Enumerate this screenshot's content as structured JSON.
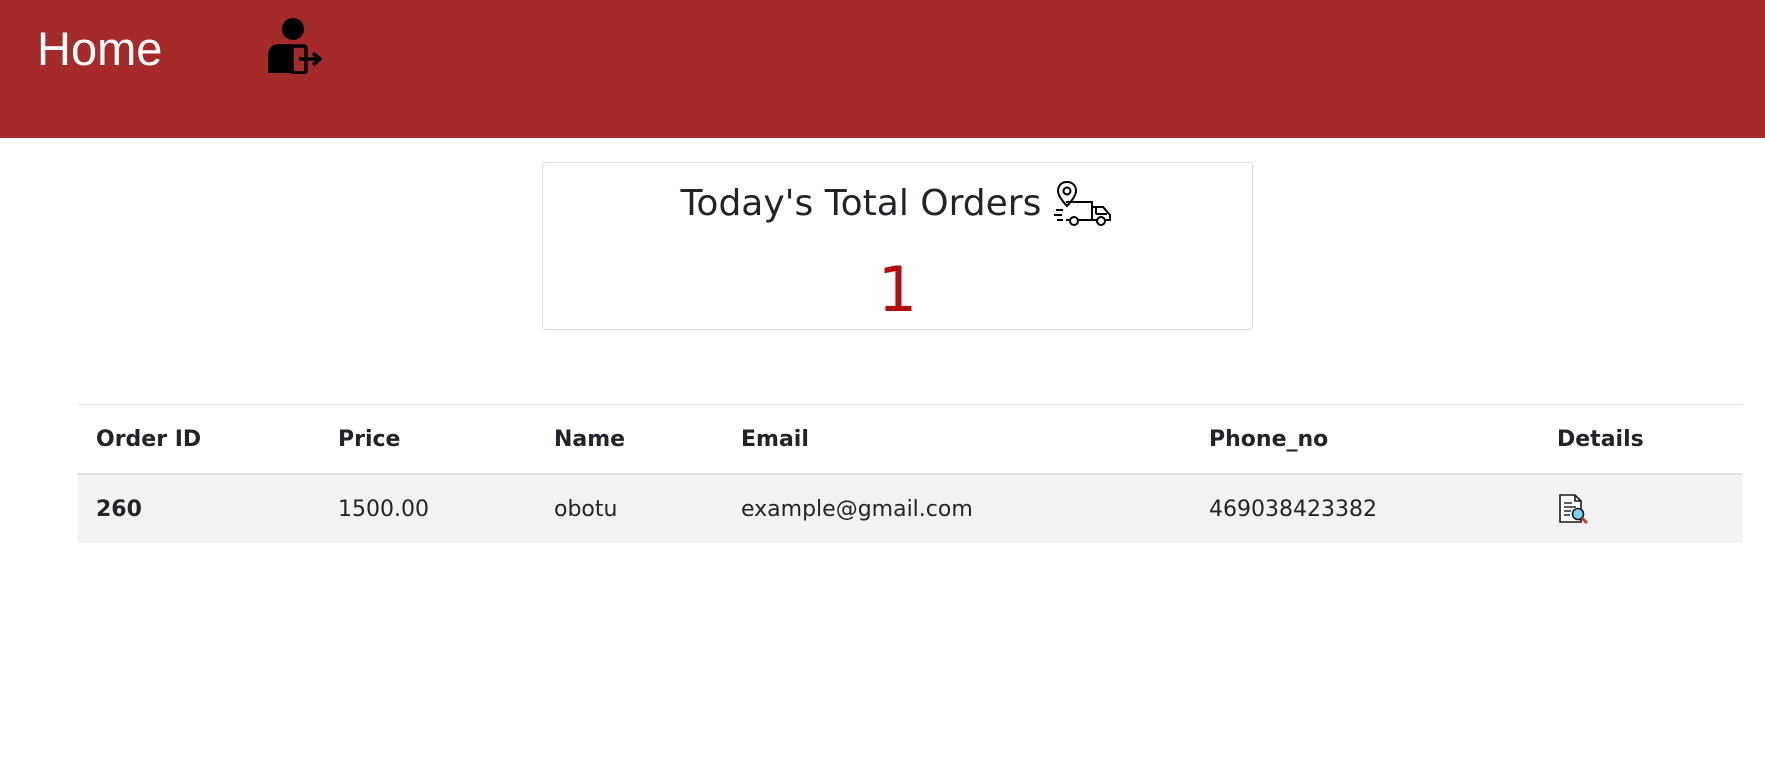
{
  "header": {
    "home_label": "Home",
    "logout_icon": "user-logout-icon",
    "background_color": "#a52a2a"
  },
  "summary_card": {
    "title": "Today's Total Orders",
    "icon": "delivery-truck-icon",
    "count": "1",
    "count_color": "#b20e10"
  },
  "orders_table": {
    "columns": [
      "Order ID",
      "Price",
      "Name",
      "Email",
      "Phone_no",
      "Details"
    ],
    "rows": [
      {
        "order_id": "260",
        "price": "1500.00",
        "name": "obotu",
        "email": "example@gmail.com",
        "phone_no": "469038423382",
        "details_icon": "document-search-icon"
      }
    ]
  }
}
